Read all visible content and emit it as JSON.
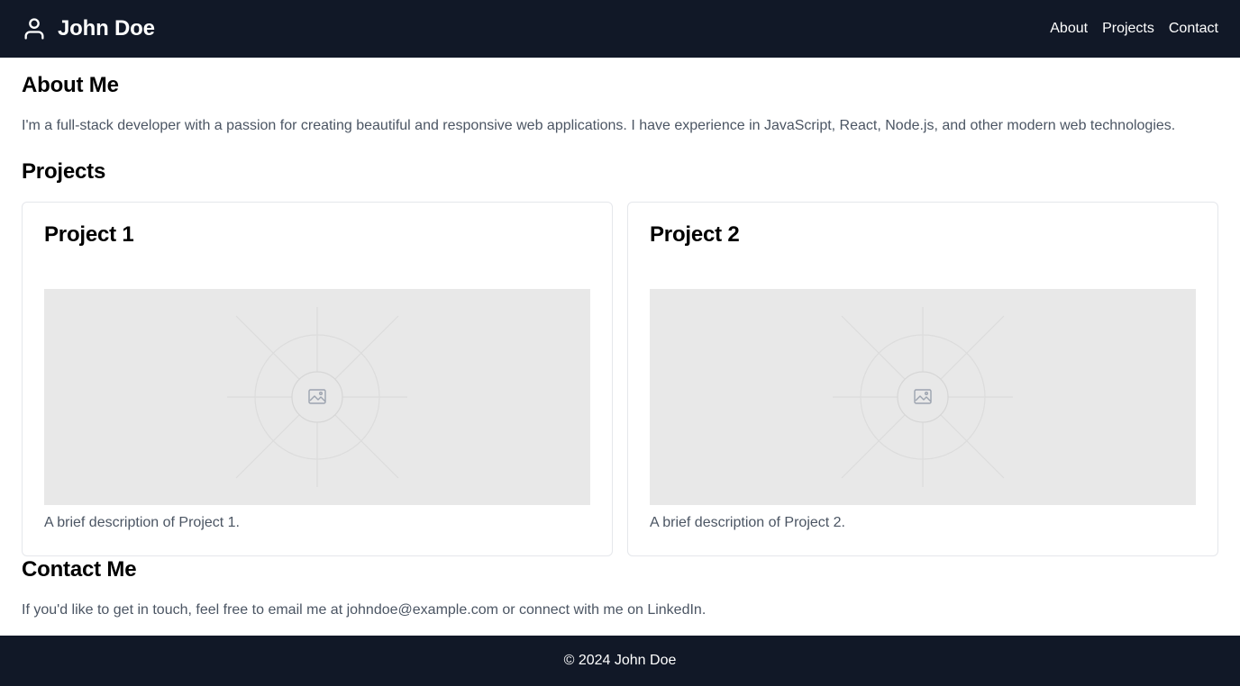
{
  "header": {
    "brand_name": "John Doe",
    "brand_icon": "user-icon",
    "nav": [
      {
        "label": "About"
      },
      {
        "label": "Projects"
      },
      {
        "label": "Contact"
      }
    ]
  },
  "about": {
    "title": "About Me",
    "text": "I'm a full-stack developer with a passion for creating beautiful and responsive web applications. I have experience in JavaScript, React, Node.js, and other modern web technologies."
  },
  "projects": {
    "title": "Projects",
    "items": [
      {
        "title": "Project 1",
        "description": "A brief description of Project 1.",
        "image_icon": "image-placeholder-icon"
      },
      {
        "title": "Project 2",
        "description": "A brief description of Project 2.",
        "image_icon": "image-placeholder-icon"
      }
    ]
  },
  "contact": {
    "title": "Contact Me",
    "text": "If you'd like to get in touch, feel free to email me at johndoe@example.com or connect with me on LinkedIn."
  },
  "footer": {
    "text": "© 2024 John Doe"
  },
  "colors": {
    "header_bg": "#111827",
    "footer_bg": "#111827",
    "body_text": "#4b5563",
    "card_border": "#e5e7eb",
    "placeholder_bg": "#e8e8e8"
  }
}
